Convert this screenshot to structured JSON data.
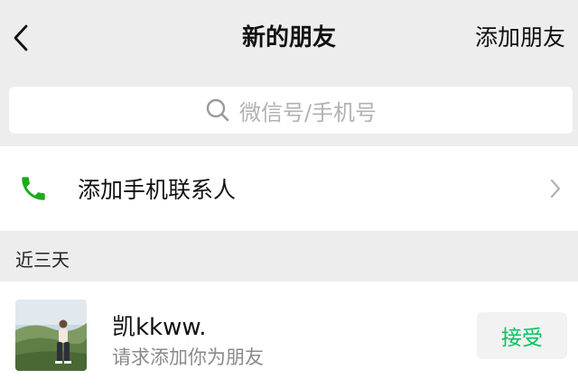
{
  "navbar": {
    "back_icon": "chevron-left-icon",
    "title": "新的朋友",
    "action_label": "添加朋友"
  },
  "search": {
    "icon": "search-icon",
    "placeholder": "微信号/手机号"
  },
  "add_phone_contacts": {
    "icon": "phone-icon",
    "label": "添加手机联系人",
    "chevron_icon": "chevron-right-icon"
  },
  "section": {
    "title": "近三天"
  },
  "requests": [
    {
      "name": "凯kkww.",
      "message": "请求添加你为朋友",
      "accept_label": "接受"
    }
  ],
  "colors": {
    "accent_green": "#07c160",
    "phone_green": "#1aad19",
    "background": "#ededed"
  }
}
